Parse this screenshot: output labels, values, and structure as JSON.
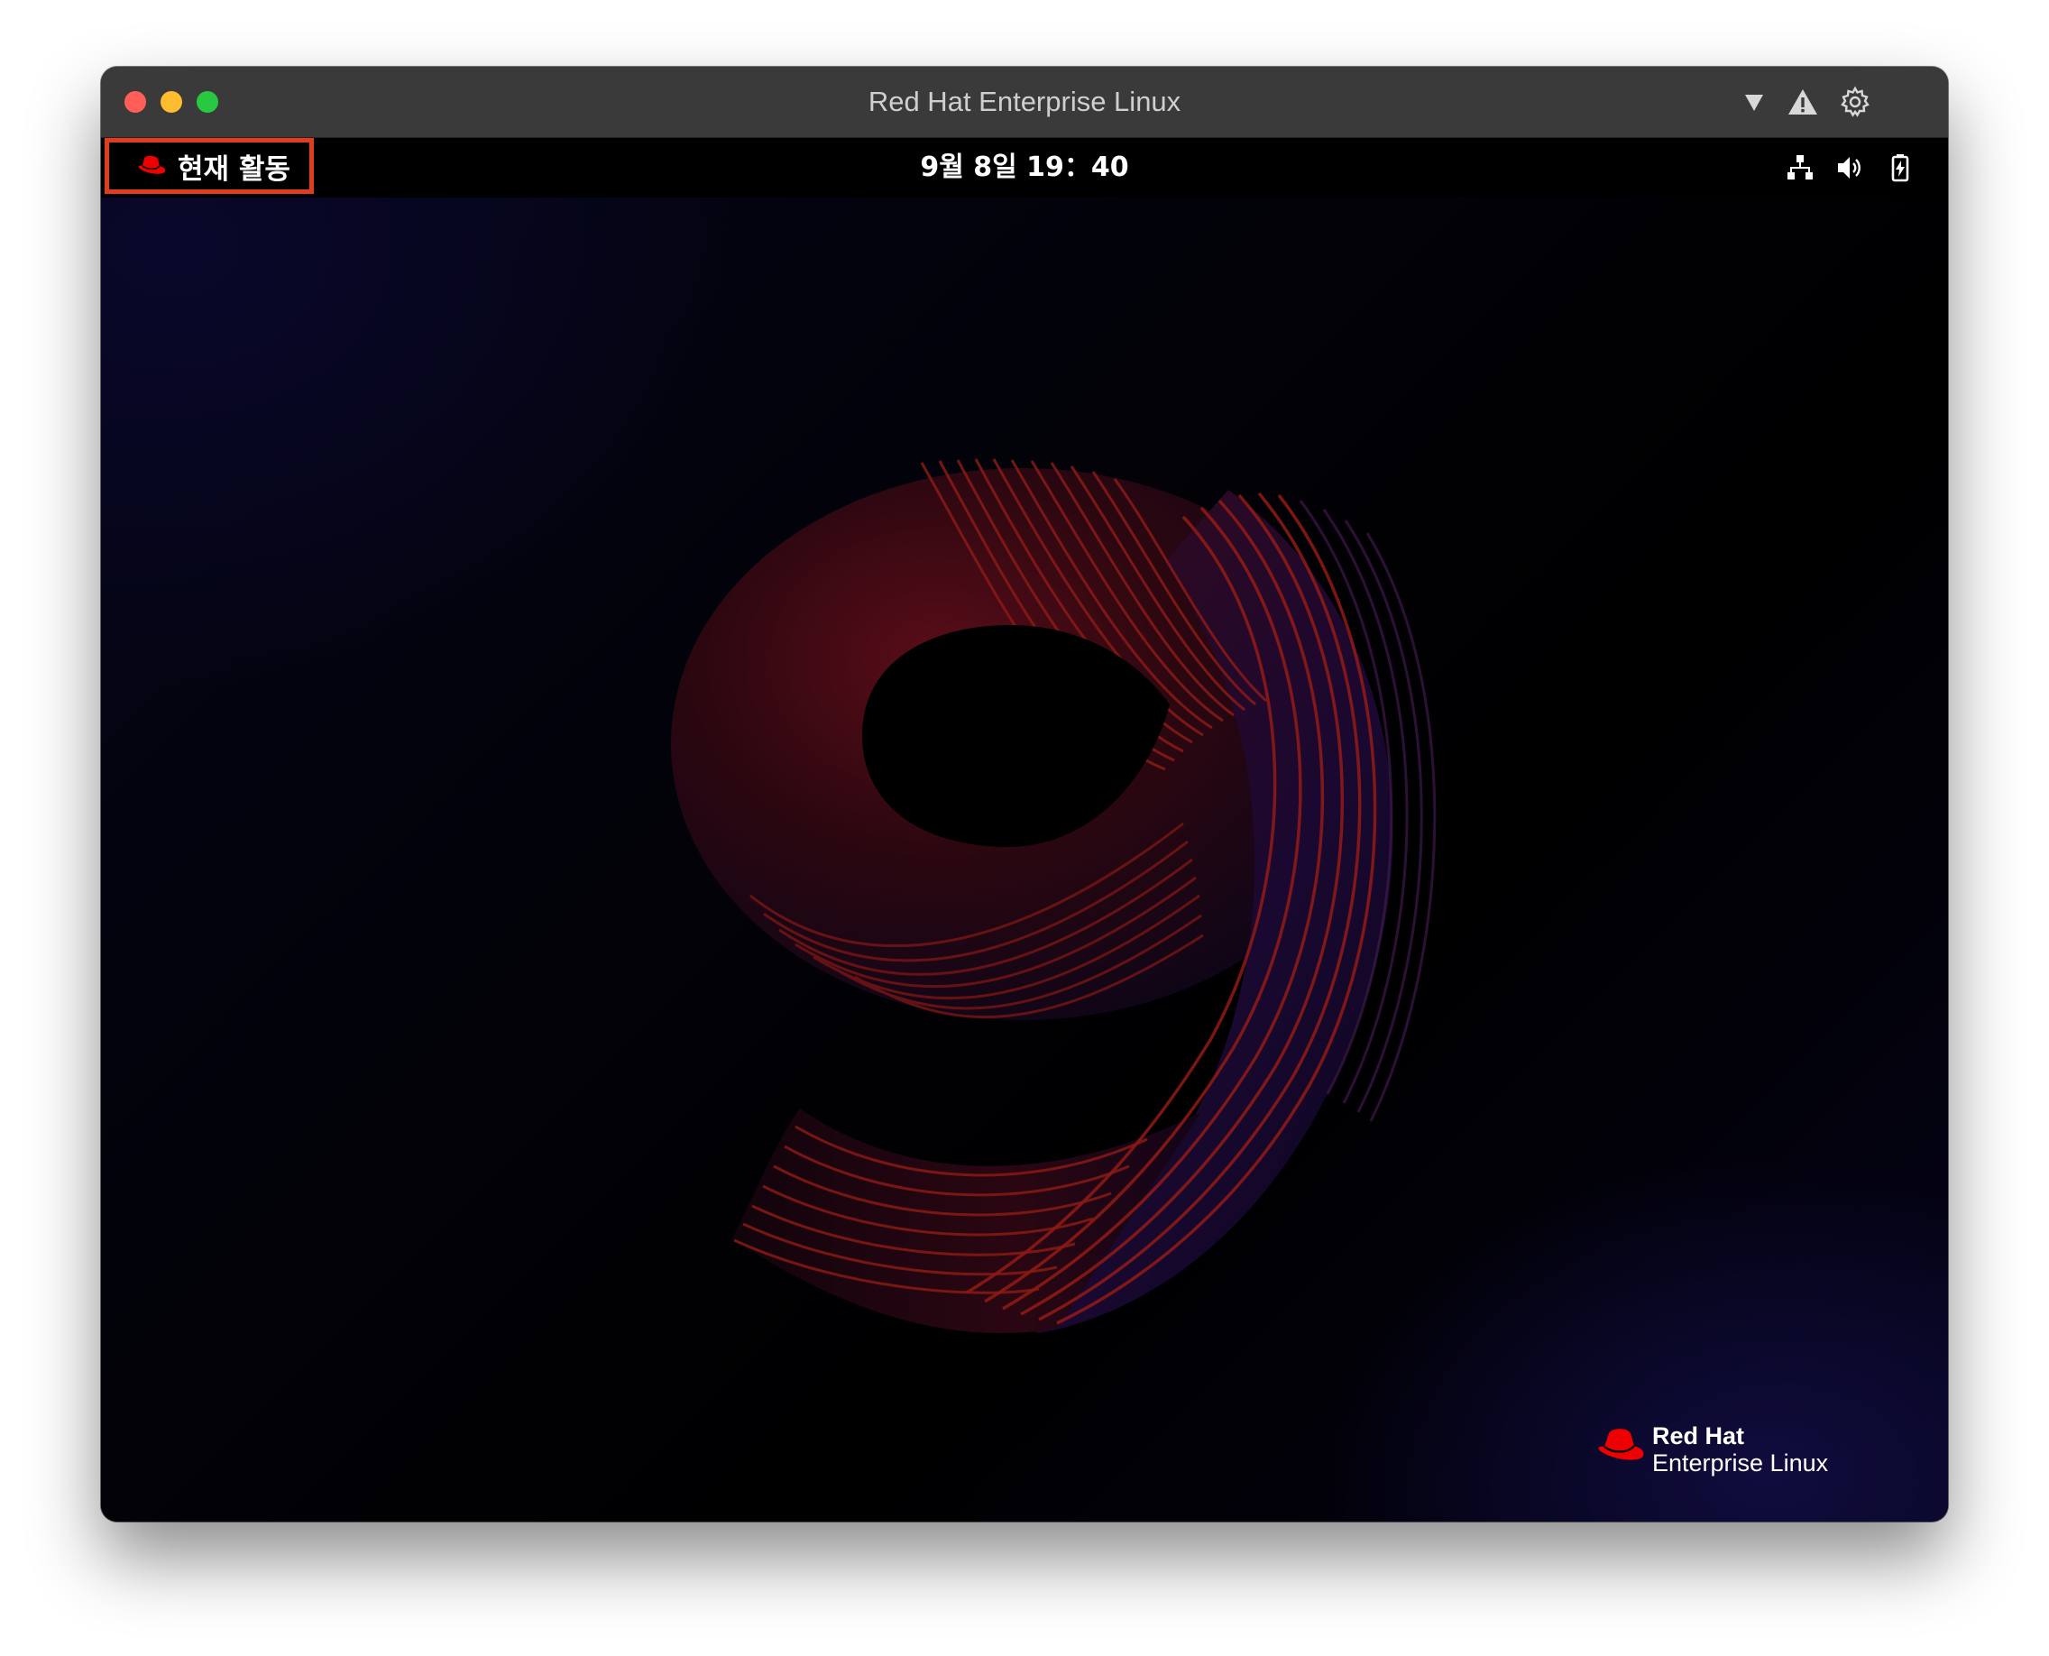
{
  "window": {
    "title": "Red Hat Enterprise Linux",
    "controls": [
      "close",
      "minimize",
      "maximize"
    ],
    "toolbar_icons": [
      "dropdown-triangle-icon",
      "warning-icon",
      "gear-icon"
    ]
  },
  "topbar": {
    "activities_label": "현재 활동",
    "activities_icon": "redhat-logo-icon",
    "clock": "9월 8일 19：40",
    "tray_icons": [
      "network-icon",
      "volume-icon",
      "battery-icon"
    ]
  },
  "desktop": {
    "wallpaper": "rhel-9-swirl",
    "brand": {
      "line1": "Red Hat",
      "line2": "Enterprise Linux"
    }
  },
  "colors": {
    "highlight_border": "#e03c1f",
    "redhat_red": "#ee0000",
    "titlebar": "#3a3a3a",
    "topbar": "#000000"
  }
}
